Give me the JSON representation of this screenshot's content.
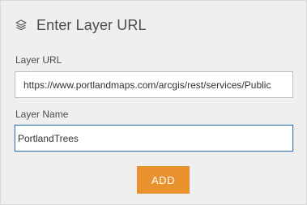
{
  "header": {
    "icon": "layers-icon",
    "title": "Enter Layer URL"
  },
  "form": {
    "url_label": "Layer URL",
    "url_value": "https://www.portlandmaps.com/arcgis/rest/services/Public",
    "name_label": "Layer Name",
    "name_value": "PortlandTrees",
    "add_label": "ADD"
  },
  "colors": {
    "panel_bg": "#efefef",
    "accent_button": "#e8912d",
    "focus_border": "#3c78b4"
  }
}
